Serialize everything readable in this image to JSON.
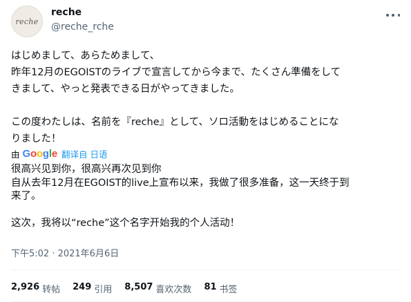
{
  "author": {
    "avatar_text": "reche",
    "display_name": "reche",
    "handle": "@reche_rche"
  },
  "tweet": {
    "text": "はじめまして、あらためまして、\n昨年12月のEGOISTのライブで宣言してから今まで、たくさん準備をして\nきまして、やっと発表できる日がやってきました。\n\nこの度わたしは、名前を『reche』として、ソロ活動をはじめることにな\nりました！"
  },
  "translation": {
    "by_label": "由",
    "provider": "Google",
    "link_label": "翻译自 日语",
    "text": "很高兴见到你，很高兴再次见到你\n自从去年12月在EGOIST的live上宣布以来，我做了很多准备，这一天终于到\n来了。\n\n这次，我将以“reche”这个名字开始我的个人活动！"
  },
  "timestamp": "下午5:02 · 2021年6月6日",
  "stats": [
    {
      "count": "2,926",
      "label": "转帖"
    },
    {
      "count": "249",
      "label": "引用"
    },
    {
      "count": "8,507",
      "label": "喜欢次数"
    },
    {
      "count": "81",
      "label": "书签"
    }
  ],
  "colors": {
    "link": "#1d9bf0",
    "secondary_text": "#536471",
    "primary_text": "#0f1419"
  }
}
